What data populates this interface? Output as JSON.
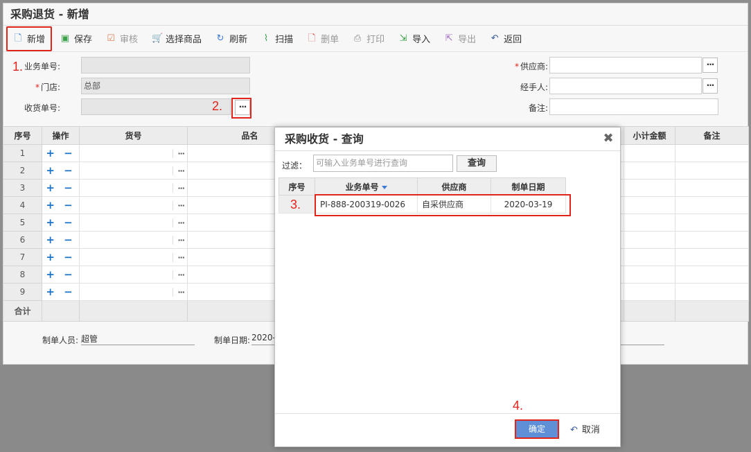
{
  "window": {
    "title": "采购退货 - 新增"
  },
  "toolbar": {
    "buttons": [
      {
        "label": "新增",
        "icon": "new-doc-icon",
        "color": "#3a7bd5",
        "enabled": true
      },
      {
        "label": "保存",
        "icon": "save-icon",
        "color": "#3aa04a",
        "enabled": true
      },
      {
        "label": "审核",
        "icon": "check-icon",
        "color": "#e0845a",
        "enabled": false
      },
      {
        "label": "选择商品",
        "icon": "cart-icon",
        "color": "#3a5a99",
        "enabled": true
      },
      {
        "label": "刷新",
        "icon": "refresh-icon",
        "color": "#3a7bd5",
        "enabled": true
      },
      {
        "label": "扫描",
        "icon": "scan-icon",
        "color": "#3aa04a",
        "enabled": true
      },
      {
        "label": "删单",
        "icon": "delete-doc-icon",
        "color": "#d9534f",
        "enabled": false
      },
      {
        "label": "打印",
        "icon": "print-icon",
        "color": "#888888",
        "enabled": false
      },
      {
        "label": "导入",
        "icon": "import-icon",
        "color": "#3aa04a",
        "enabled": true
      },
      {
        "label": "导出",
        "icon": "export-icon",
        "color": "#a070c0",
        "enabled": false
      },
      {
        "label": "返回",
        "icon": "back-icon",
        "color": "#3a5a99",
        "enabled": true
      }
    ]
  },
  "form": {
    "biz_no_label": "业务单号:",
    "biz_no_value": "",
    "store_label": "门店:",
    "store_value": "总部",
    "receipt_no_label": "收货单号:",
    "receipt_no_value": "",
    "supplier_label": "供应商:",
    "supplier_value": "",
    "handler_label": "经手人:",
    "handler_value": "",
    "remark_label": "备注:",
    "remark_value": "",
    "required_mark": "*",
    "dots": "···"
  },
  "grid": {
    "headers": [
      "序号",
      "操作",
      "货号",
      "品名",
      "",
      "小计金额",
      "备注"
    ],
    "rows": [
      "1",
      "2",
      "3",
      "4",
      "5",
      "6",
      "7",
      "8",
      "9"
    ],
    "ops": "+ −",
    "dots": "···",
    "sum_label": "合计"
  },
  "footer": {
    "creator_label": "制单人员:",
    "creator_value": "超管",
    "date_label": "制单日期:",
    "date_value": "2020-"
  },
  "steps": [
    "1.",
    "2.",
    "3.",
    "4."
  ],
  "dialog": {
    "title": "采购收货 - 查询",
    "close": "✖",
    "filter_label": "过滤：",
    "filter_placeholder": "可输入业务单号进行查询",
    "query_button": "查询",
    "headers": [
      "序号",
      "业务单号",
      "供应商",
      "制单日期"
    ],
    "rows": [
      {
        "no": "",
        "biz_no": "PI-888-200319-0026",
        "supplier": "自采供应商",
        "date": "2020-03-19"
      }
    ],
    "ok_button": "确定",
    "cancel_button": "取消"
  },
  "colors": {
    "highlight": "#e2231a",
    "primary": "#5f8fd6",
    "accent": "#1a73c8"
  }
}
